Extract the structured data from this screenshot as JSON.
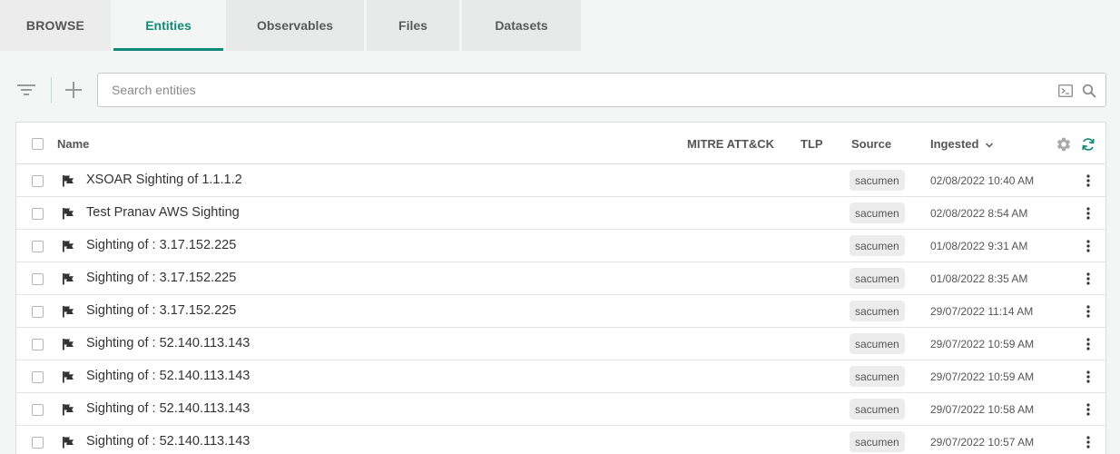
{
  "tabs": [
    {
      "label": "BROWSE",
      "active": false
    },
    {
      "label": "Entities",
      "active": true
    },
    {
      "label": "Observables",
      "active": false
    },
    {
      "label": "Files",
      "active": false
    },
    {
      "label": "Datasets",
      "active": false
    }
  ],
  "search": {
    "placeholder": "Search entities",
    "value": ""
  },
  "table": {
    "columns": {
      "name": "Name",
      "mitre": "MITRE ATT&CK",
      "tlp": "TLP",
      "source": "Source",
      "ingested": "Ingested"
    },
    "sort": {
      "column": "Ingested",
      "direction": "desc"
    },
    "rows": [
      {
        "name": "XSOAR Sighting of 1.1.1.2",
        "source": "sacumen",
        "ingested": "02/08/2022 10:40 AM"
      },
      {
        "name": "Test Pranav AWS Sighting",
        "source": "sacumen",
        "ingested": "02/08/2022 8:54 AM"
      },
      {
        "name": "Sighting of : 3.17.152.225",
        "source": "sacumen",
        "ingested": "01/08/2022 9:31 AM"
      },
      {
        "name": "Sighting of : 3.17.152.225",
        "source": "sacumen",
        "ingested": "01/08/2022 8:35 AM"
      },
      {
        "name": "Sighting of : 3.17.152.225",
        "source": "sacumen",
        "ingested": "29/07/2022 11:14 AM"
      },
      {
        "name": "Sighting of : 52.140.113.143",
        "source": "sacumen",
        "ingested": "29/07/2022 10:59 AM"
      },
      {
        "name": "Sighting of : 52.140.113.143",
        "source": "sacumen",
        "ingested": "29/07/2022 10:59 AM"
      },
      {
        "name": "Sighting of : 52.140.113.143",
        "source": "sacumen",
        "ingested": "29/07/2022 10:58 AM"
      },
      {
        "name": "Sighting of : 52.140.113.143",
        "source": "sacumen",
        "ingested": "29/07/2022 10:57 AM"
      }
    ]
  },
  "icons": {
    "filter": "filter-icon",
    "add": "plus-icon",
    "console": "console-icon",
    "search": "search-icon",
    "settings": "gear-icon",
    "refresh": "refresh-icon",
    "row_type": "flag-icon",
    "row_menu": "kebab-menu-icon"
  },
  "colors": {
    "accent": "#0f8a76",
    "tab_bg": "#e8e9e9",
    "page_bg": "#f4f6f5"
  }
}
